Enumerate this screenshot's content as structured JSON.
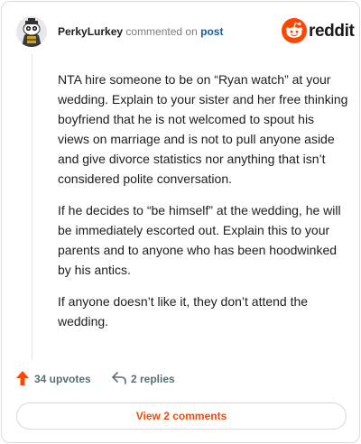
{
  "header": {
    "username": "PerkyLurkey",
    "commented_on": "commented on",
    "post_link": "post",
    "brand_name": "reddit"
  },
  "comment": {
    "paragraphs": [
      "NTA hire someone to be on “Ryan watch” at your wedding. Explain to your sister and her free thinking boyfriend that he is not welcomed to spout his views on marriage and is not to pull anyone aside and give divorce statistics nor anything that isn’t considered polite conversation.",
      "If he decides to “be himself” at the wedding, he will be immediately escorted out. Explain this to your parents and to anyone who has been hoodwinked by his antics.",
      "If anyone doesn’t like it, they don’t attend the wedding."
    ]
  },
  "actions": {
    "upvotes_label": "34 upvotes",
    "replies_label": "2 replies"
  },
  "footer": {
    "view_comments_label": "View 2 comments"
  },
  "colors": {
    "accent": "#ff4500",
    "link": "#0f5fa8",
    "muted": "#576f76"
  },
  "icons": {
    "avatar": "snoo-avatar-icon",
    "brand": "reddit-logo-icon",
    "upvote": "upvote-arrow-icon",
    "reply": "reply-arrow-icon"
  }
}
